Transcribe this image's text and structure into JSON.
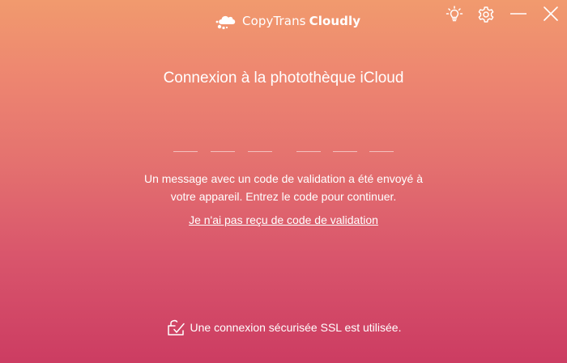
{
  "app": {
    "name_light": "CopyTrans",
    "name_bold": "Cloudly"
  },
  "controls": {
    "tips_icon": "lightbulb-icon",
    "settings_icon": "gear-icon",
    "minimize_icon": "minimize-icon",
    "close_icon": "close-icon"
  },
  "main": {
    "title": "Connexion à la photothèque iCloud",
    "code_slot_count": 6,
    "code_values": [
      "",
      "",
      "",
      "",
      "",
      ""
    ],
    "message_line1": "Un message avec un code de validation a été envoyé à",
    "message_line2": "votre appareil. Entrez le code pour continuer.",
    "resend_link": "Je n'ai pas reçu de code de validation"
  },
  "footer": {
    "ssl_icon": "lock-check-icon",
    "ssl_text": "Une connexion sécurisée SSL est utilisée."
  },
  "colors": {
    "gradient_top": "#f19a6e",
    "gradient_bottom": "#cc3c62",
    "text": "#ffffff"
  }
}
